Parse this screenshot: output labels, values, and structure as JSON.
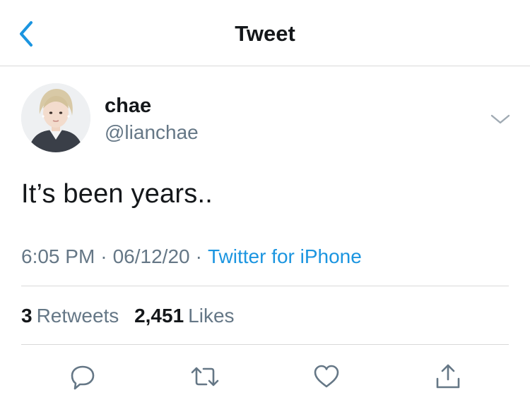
{
  "header": {
    "title": "Tweet",
    "back_icon": "chevron-left-icon"
  },
  "tweet": {
    "display_name": "chae",
    "handle": "@lianchae",
    "text": "It’s been years..",
    "time": "6:05 PM",
    "separator": "·",
    "date": "06/12/20",
    "source": "Twitter for iPhone"
  },
  "stats": {
    "retweets_count": "3",
    "retweets_label": "Retweets",
    "likes_count": "2,451",
    "likes_label": "Likes"
  },
  "actions": {
    "reply_icon": "reply-icon",
    "retweet_icon": "retweet-icon",
    "like_icon": "heart-icon",
    "share_icon": "share-icon"
  },
  "colors": {
    "accent": "#1b95e0",
    "text": "#14171a",
    "secondary": "#657786",
    "divider": "#d9d9d9"
  }
}
